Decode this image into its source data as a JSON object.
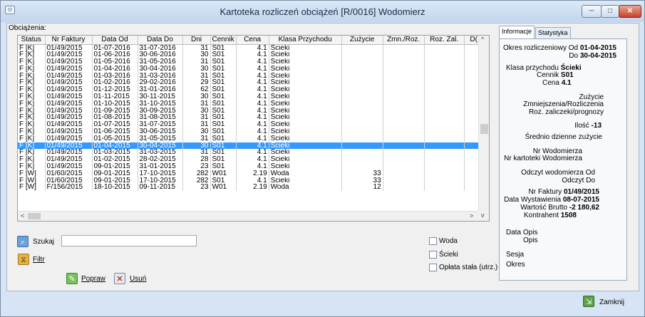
{
  "window": {
    "title": "Kartoteka rozliczeń obciążeń [R/0016] Wodomierz",
    "minimize_glyph": "─",
    "maximize_glyph": "□",
    "close_glyph": "✕",
    "app_icon_glyph": "⊙"
  },
  "grid": {
    "group_label": "Obciążenia:",
    "columns": [
      "Status",
      "Nr Faktury",
      "Data Od",
      "Data Do",
      "Dni",
      "Cennik",
      "Cena",
      "Klasa Przychodu",
      "Zużycie",
      "Zmn./Roz.",
      "Roz. Zal.",
      "D("
    ],
    "selected_row": 14,
    "rows": [
      [
        "F [K]",
        "01/49/2015",
        "01-07-2016",
        "31-07-2016",
        "31",
        "S01",
        "4.1",
        "Ścieki",
        "",
        "",
        "",
        ""
      ],
      [
        "F [K]",
        "01/49/2015",
        "01-06-2016",
        "30-06-2016",
        "30",
        "S01",
        "4.1",
        "Ścieki",
        "",
        "",
        "",
        ""
      ],
      [
        "F [K]",
        "01/49/2015",
        "01-05-2016",
        "31-05-2016",
        "31",
        "S01",
        "4.1",
        "Ścieki",
        "",
        "",
        "",
        ""
      ],
      [
        "F [K]",
        "01/49/2015",
        "01-04-2016",
        "30-04-2016",
        "30",
        "S01",
        "4.1",
        "Ścieki",
        "",
        "",
        "",
        ""
      ],
      [
        "F [K]",
        "01/49/2015",
        "01-03-2016",
        "31-03-2016",
        "31",
        "S01",
        "4.1",
        "Ścieki",
        "",
        "",
        "",
        ""
      ],
      [
        "F [K]",
        "01/49/2015",
        "01-02-2016",
        "29-02-2016",
        "29",
        "S01",
        "4.1",
        "Ścieki",
        "",
        "",
        "",
        ""
      ],
      [
        "F [K]",
        "01/49/2015",
        "01-12-2015",
        "31-01-2016",
        "62",
        "S01",
        "4.1",
        "Ścieki",
        "",
        "",
        "",
        ""
      ],
      [
        "F [K]",
        "01/49/2015",
        "01-11-2015",
        "30-11-2015",
        "30",
        "S01",
        "4.1",
        "Ścieki",
        "",
        "",
        "",
        ""
      ],
      [
        "F [K]",
        "01/49/2015",
        "01-10-2015",
        "31-10-2015",
        "31",
        "S01",
        "4.1",
        "Ścieki",
        "",
        "",
        "",
        ""
      ],
      [
        "F [K]",
        "01/49/2015",
        "01-09-2015",
        "30-09-2015",
        "30",
        "S01",
        "4.1",
        "Ścieki",
        "",
        "",
        "",
        ""
      ],
      [
        "F [K]",
        "01/49/2015",
        "01-08-2015",
        "31-08-2015",
        "31",
        "S01",
        "4.1",
        "Ścieki",
        "",
        "",
        "",
        ""
      ],
      [
        "F [K]",
        "01/49/2015",
        "01-07-2015",
        "31-07-2015",
        "31",
        "S01",
        "4.1",
        "Ścieki",
        "",
        "",
        "",
        ""
      ],
      [
        "F [K]",
        "01/49/2015",
        "01-06-2015",
        "30-06-2015",
        "30",
        "S01",
        "4.1",
        "Ścieki",
        "",
        "",
        "",
        ""
      ],
      [
        "F [K]",
        "01/49/2015",
        "01-05-2015",
        "31-05-2015",
        "31",
        "S01",
        "4.1",
        "Ścieki",
        "",
        "",
        "",
        ""
      ],
      [
        "F [K]",
        "01/49/2015",
        "01-04-2015",
        "30-04-2015",
        "30",
        "S01",
        "4.1",
        "Ścieki",
        "",
        "",
        "",
        ""
      ],
      [
        "F [K]",
        "01/49/2015",
        "01-03-2015",
        "31-03-2015",
        "31",
        "S01",
        "4.1",
        "Ścieki",
        "",
        "",
        "",
        ""
      ],
      [
        "F [K]",
        "01/49/2015",
        "01-02-2015",
        "28-02-2015",
        "28",
        "S01",
        "4.1",
        "Ścieki",
        "",
        "",
        "",
        ""
      ],
      [
        "F [K]",
        "01/49/2015",
        "09-01-2015",
        "31-01-2015",
        "23",
        "S01",
        "4.1",
        "Ścieki",
        "",
        "",
        "",
        ""
      ],
      [
        "F [W]",
        "01/60/2015",
        "09-01-2015",
        "17-10-2015",
        "282",
        "W01",
        "2.19",
        "Woda",
        "33",
        "",
        "",
        ""
      ],
      [
        "F [W]",
        "01/60/2015",
        "09-01-2015",
        "17-10-2015",
        "282",
        "S01",
        "4.1",
        "Ścieki",
        "33",
        "",
        "",
        ""
      ],
      [
        "F [W]",
        "F/156/2015",
        "18-10-2015",
        "09-11-2015",
        "23",
        "W01",
        "2.19",
        "Woda",
        "12",
        "",
        "",
        ""
      ]
    ],
    "scroll_left": "<",
    "scroll_right": ">",
    "scroll_up": "^",
    "scroll_down": "v"
  },
  "actions": {
    "search_label": "Szukaj",
    "search_value": "",
    "filter_label": "Filtr",
    "edit_label": "Popraw",
    "delete_label": "Usuń",
    "close_label": "Zamknij"
  },
  "filters": {
    "woda": "Woda",
    "scieki": "Ścieki",
    "oplata": "Opłata stała (utrz.)"
  },
  "tabs": [
    "Informacje",
    "Statystyka"
  ],
  "info": {
    "okres_label": "Okres rozliczeniowy Od",
    "okres_od": "01-04-2015",
    "do_label": "Do",
    "okres_do": "30-04-2015",
    "klasa_label": "Klasa przychodu",
    "klasa": "Ścieki",
    "cennik_label": "Cennik",
    "cennik": "S01",
    "cena_label": "Cena",
    "cena": "4.1",
    "zuzycie_label": "Zużycie",
    "zmniejszenia_label": "Zmniejszenia/Rozliczenia",
    "roz_zal_label": "Roz. zaliczeki/prognozy",
    "ilosc_label": "Ilość",
    "ilosc": "-13",
    "srednio_label": "Średnio dzienne zużycie",
    "nr_wod_label": "Nr Wodomierza",
    "nr_kart_label": "Nr kartoteki Wodomierza",
    "odczyt_od_label": "Odczyt wodomierza Od",
    "odczyt_do_label": "Odczyt Do",
    "nr_fakt_label": "Nr Faktury",
    "nr_fakt": "01/49/2015",
    "data_wyst_label": "Data Wystawienia",
    "data_wyst": "08-07-2015",
    "wartosc_label": "Wartość Brutto",
    "wartosc": "-2 180,62",
    "kontrahent_label": "Kontrahent",
    "kontrahent": "1508",
    "data_opis_label": "Data Opis",
    "opis_label": "Opis",
    "sesja_label": "Sesja",
    "okres2_label": "Okres"
  }
}
